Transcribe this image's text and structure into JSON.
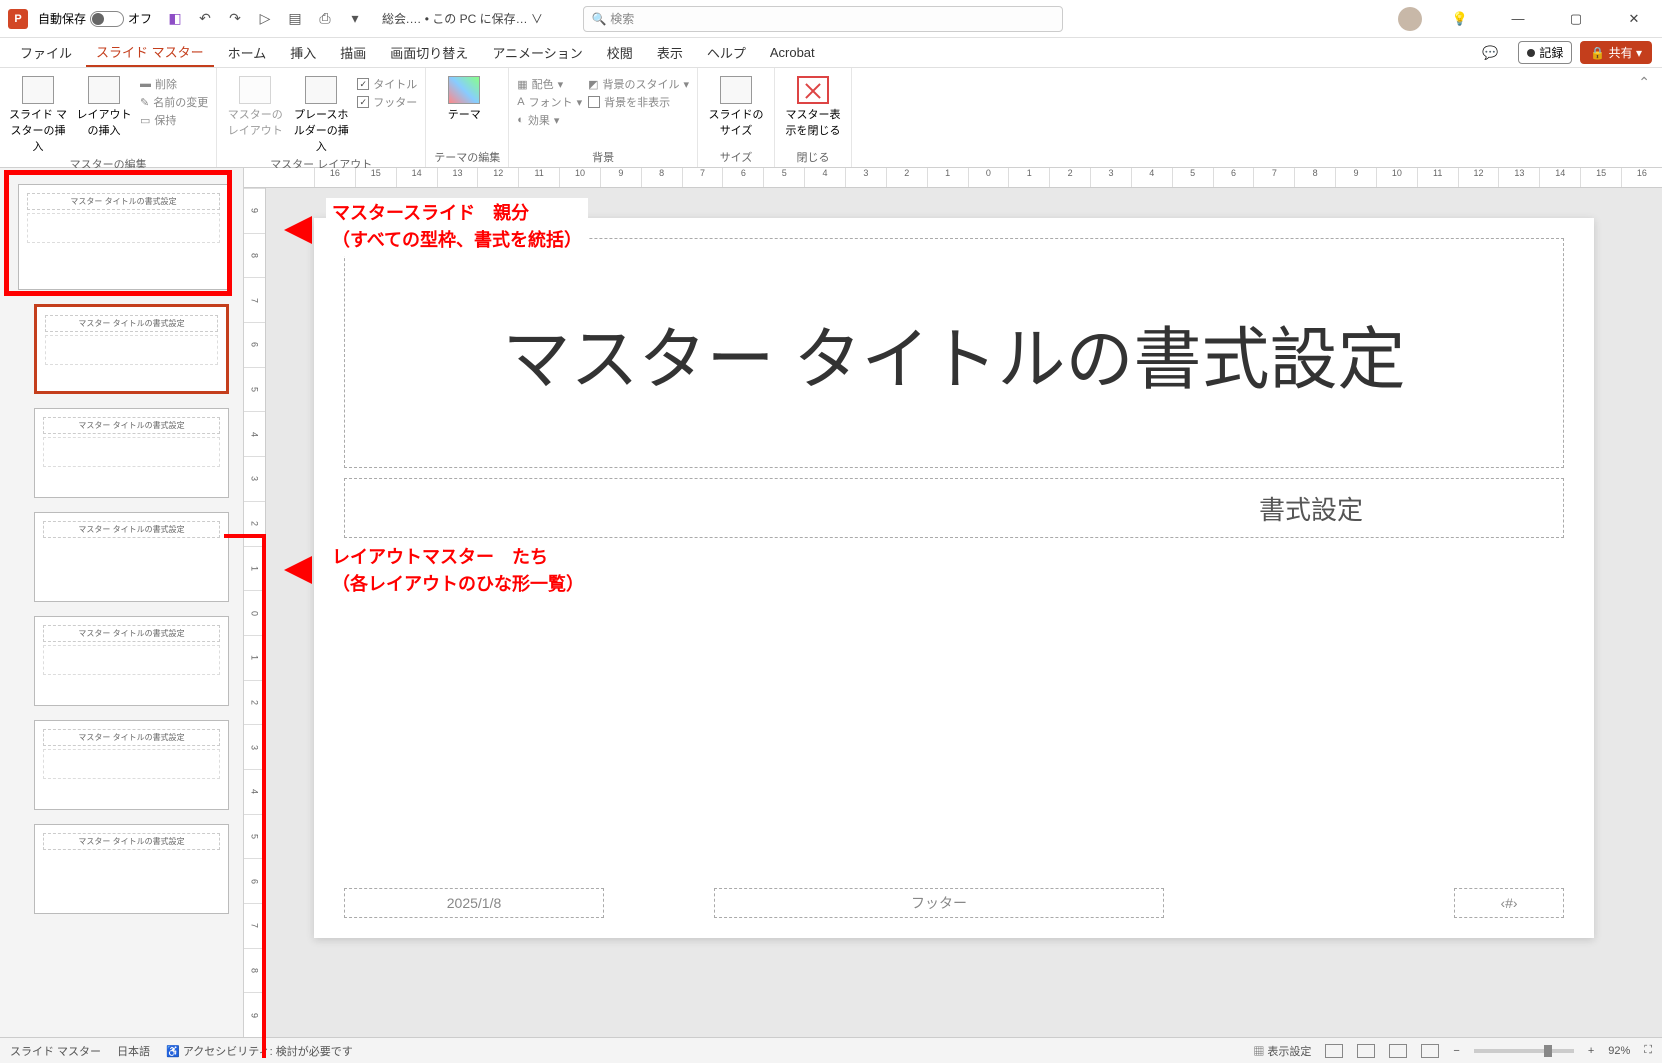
{
  "titlebar": {
    "autosave_label": "自動保存",
    "autosave_state": "オフ",
    "doc_title": "総会.… • この PC に保存… ∨",
    "search_placeholder": "検索"
  },
  "window_controls": {
    "min": "—",
    "max": "▢",
    "close": "✕"
  },
  "tabs": {
    "file": "ファイル",
    "slidemaster": "スライド マスター",
    "home": "ホーム",
    "insert": "挿入",
    "draw": "描画",
    "transitions": "画面切り替え",
    "animations": "アニメーション",
    "review": "校閲",
    "view": "表示",
    "help": "ヘルプ",
    "acrobat": "Acrobat",
    "record": "記録",
    "share": "共有"
  },
  "ribbon": {
    "g1": {
      "insert_master": "スライド マスターの挿入",
      "insert_layout": "レイアウトの挿入",
      "delete": "削除",
      "rename": "名前の変更",
      "preserve": "保持",
      "label": "マスターの編集"
    },
    "g2": {
      "master_layout": "マスターのレイアウト",
      "insert_ph": "プレースホルダーの挿入",
      "chk_title": "タイトル",
      "chk_footer": "フッター",
      "label": "マスター レイアウト"
    },
    "g3": {
      "themes": "テーマ",
      "label": "テーマの編集"
    },
    "g4": {
      "colors": "配色",
      "fonts": "フォント",
      "effects": "効果",
      "bgstyles": "背景のスタイル",
      "hidebg": "背景を非表示",
      "label": "背景"
    },
    "g5": {
      "size": "スライドのサイズ",
      "label": "サイズ"
    },
    "g6": {
      "close": "マスター表示を閉じる",
      "label": "閉じる"
    }
  },
  "ruler_h": [
    "16",
    "15",
    "14",
    "13",
    "12",
    "11",
    "10",
    "9",
    "8",
    "7",
    "6",
    "5",
    "4",
    "3",
    "2",
    "1",
    "0",
    "1",
    "2",
    "3",
    "4",
    "5",
    "6",
    "7",
    "8",
    "9",
    "10",
    "11",
    "12",
    "13",
    "14",
    "15",
    "16"
  ],
  "ruler_v": [
    "9",
    "8",
    "7",
    "6",
    "5",
    "4",
    "3",
    "2",
    "1",
    "0",
    "1",
    "2",
    "3",
    "4",
    "5",
    "6",
    "7",
    "8",
    "9"
  ],
  "slide": {
    "title": "マスター タイトルの書式設定",
    "subtitle": "書式設定",
    "date": "2025/1/8",
    "footer": "フッター",
    "pagenum": "‹#›"
  },
  "thumbs": {
    "master_text": "マスター タイトルの書式設定",
    "layout_text": "マスター タイトルの書式設定"
  },
  "annotations": {
    "a1_line1": "マスタースライド　親分",
    "a1_line2": "（すべての型枠、書式を統括）",
    "a2_line1": "レイアウトマスター　たち",
    "a2_line2": "（各レイアウトのひな形一覧）"
  },
  "status": {
    "mode": "スライド マスター",
    "lang": "日本語",
    "access": "アクセシビリティ: 検討が必要です",
    "display": "表示設定",
    "zoom": "92%"
  }
}
